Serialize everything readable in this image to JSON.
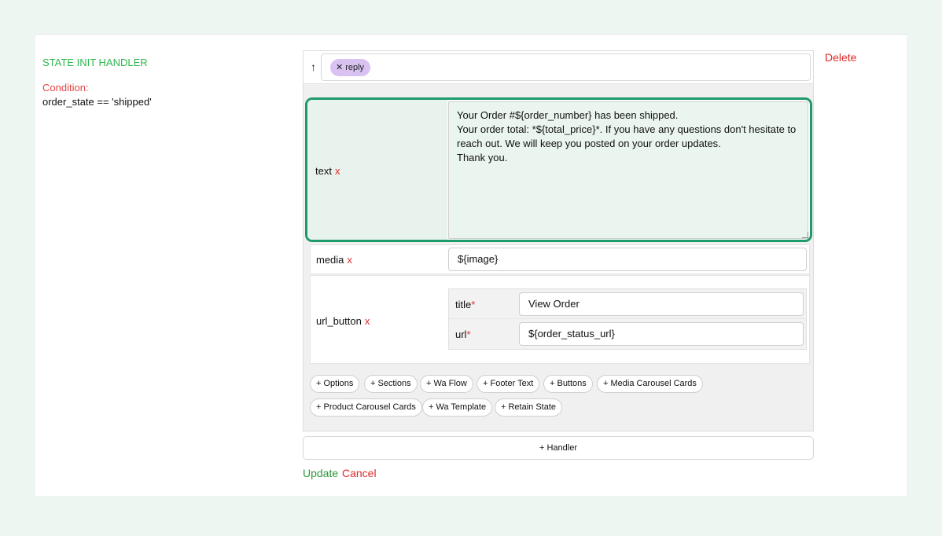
{
  "handler": {
    "title": "STATE INIT HANDLER",
    "condition_label": "Condition:",
    "condition_value": "order_state == 'shipped'",
    "delete_label": "Delete"
  },
  "reply_tag": {
    "up_arrow": "↑",
    "chip_remove": "✕",
    "chip_label": "reply"
  },
  "fields": {
    "remove_marker": "x",
    "text": {
      "label": "text",
      "value": "Your Order #${order_number} has been shipped.\nYour order total: *${total_price}*. If you have any questions don't hesitate to\nreach out. We will keep you posted on your order updates.\nThank you."
    },
    "media": {
      "label": "media",
      "value": "${image}"
    },
    "url_button": {
      "label": "url_button",
      "title_label": "title",
      "title_value": "View Order",
      "url_label": "url",
      "url_value": "${order_status_url}",
      "required_marker": "*"
    }
  },
  "add_buttons": [
    "+ Options",
    "+ Sections",
    "+ Wa Flow",
    "+ Footer Text",
    "+ Buttons",
    "+ Media Carousel Cards",
    "+ Product Carousel Cards",
    "+ Wa Template",
    "+ Retain State"
  ],
  "footer": {
    "add_handler_label": "+ Handler",
    "update_label": "Update",
    "cancel_label": "Cancel"
  },
  "colors": {
    "accent_green": "#2db84d",
    "focus_border": "#1f9a6a",
    "danger_red": "#e02a2a",
    "chip_purple": "#d9c2f2"
  }
}
